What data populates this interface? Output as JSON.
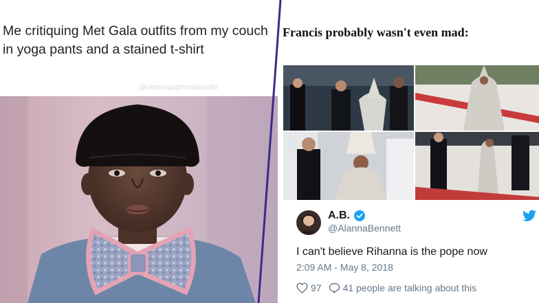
{
  "left_meme": {
    "caption": "Me critiquing Met Gala outfits from my couch in yoga pants and a stained t-shirt",
    "watermark": "@cleaninguptheclassiclife"
  },
  "right_meme": {
    "caption": "Francis probably wasn't even mad:",
    "tweet": {
      "display_name": "A.B.",
      "handle": "@AlannaBennett",
      "text": "I can't believe Rihanna is the pope now",
      "timestamp": "2:09 AM - May 8, 2018",
      "like_count": "97",
      "reply_text": "41 people are talking about this"
    }
  },
  "icons": {
    "verified": "verified-badge-icon",
    "platform": "twitter-bird-icon",
    "like": "heart-icon",
    "reply": "speech-bubble-icon"
  },
  "colors": {
    "twitter_blue": "#1da1f2",
    "divider": "#3b2a8a",
    "muted_text": "#657786"
  }
}
